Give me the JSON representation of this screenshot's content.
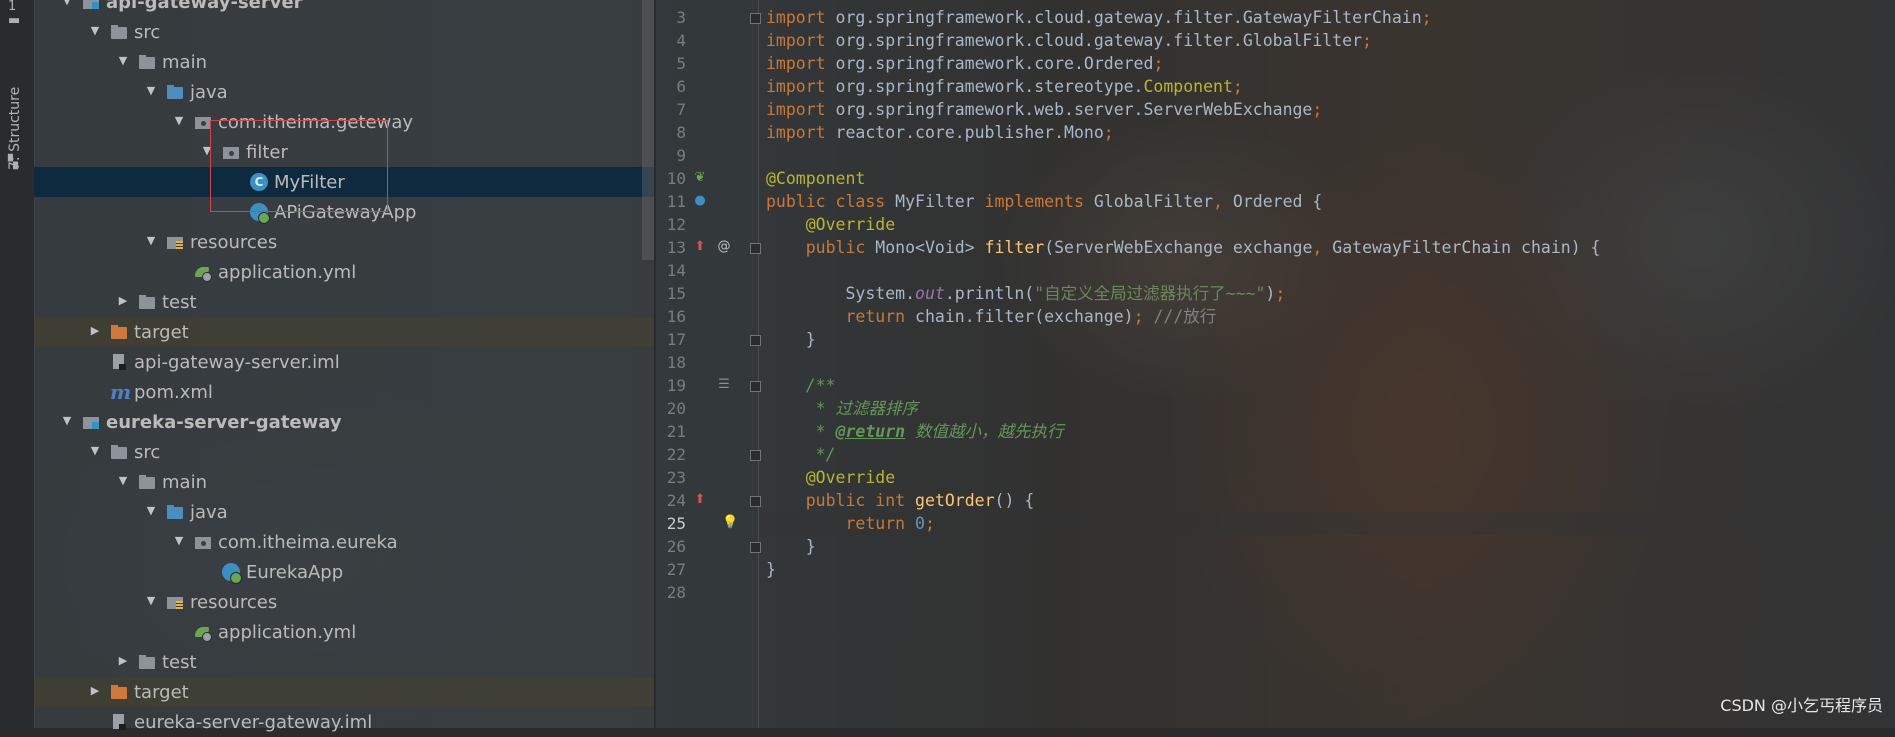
{
  "strip": {
    "number_label": "1",
    "structure_label": "7: Structure"
  },
  "tree": [
    {
      "label": "api-gateway-server",
      "icon": "module",
      "bold": true
    },
    {
      "label": "src",
      "icon": "folder"
    },
    {
      "label": "main",
      "icon": "folder"
    },
    {
      "label": "java",
      "icon": "folder-blue"
    },
    {
      "label": "com.itheima.geteway",
      "icon": "package"
    },
    {
      "label": "filter",
      "icon": "package"
    },
    {
      "label": "MyFilter",
      "icon": "class",
      "selected": true
    },
    {
      "label": "APiGatewayApp",
      "icon": "spring-app"
    },
    {
      "label": "resources",
      "icon": "resources"
    },
    {
      "label": "application.yml",
      "icon": "yml"
    },
    {
      "label": "test",
      "icon": "folder"
    },
    {
      "label": "target",
      "icon": "folder-orange"
    },
    {
      "label": "api-gateway-server.iml",
      "icon": "iml"
    },
    {
      "label": "pom.xml",
      "icon": "maven"
    },
    {
      "label": "eureka-server-gateway",
      "icon": "module",
      "bold": true
    },
    {
      "label": "src",
      "icon": "folder"
    },
    {
      "label": "main",
      "icon": "folder"
    },
    {
      "label": "java",
      "icon": "folder-blue"
    },
    {
      "label": "com.itheima.eureka",
      "icon": "package"
    },
    {
      "label": "EurekaApp",
      "icon": "spring-app"
    },
    {
      "label": "resources",
      "icon": "resources"
    },
    {
      "label": "application.yml",
      "icon": "yml"
    },
    {
      "label": "test",
      "icon": "folder"
    },
    {
      "label": "target",
      "icon": "folder-orange"
    },
    {
      "label": "eureka-server-gateway.iml",
      "icon": "iml"
    }
  ],
  "class_icon_letter": "C",
  "editor": {
    "line_numbers": [
      "3",
      "4",
      "5",
      "6",
      "7",
      "8",
      "9",
      "10",
      "11",
      "12",
      "13",
      "14",
      "15",
      "16",
      "17",
      "18",
      "19",
      "20",
      "21",
      "22",
      "23",
      "24",
      "25",
      "26",
      "27",
      "28"
    ],
    "current_line": "25",
    "code_lines": [
      [
        [
          "k",
          "import "
        ],
        [
          "",
          "org.springframework.cloud.gateway.filter.GatewayFilterChain"
        ],
        [
          "k",
          ";"
        ]
      ],
      [
        [
          "k",
          "import "
        ],
        [
          "",
          "org.springframework.cloud.gateway.filter.GlobalFilter"
        ],
        [
          "k",
          ";"
        ]
      ],
      [
        [
          "k",
          "import "
        ],
        [
          "",
          "org.springframework.core.Ordered"
        ],
        [
          "k",
          ";"
        ]
      ],
      [
        [
          "k",
          "import "
        ],
        [
          "",
          "org.springframework.stereotype."
        ],
        [
          "a",
          "Component"
        ],
        [
          "k",
          ";"
        ]
      ],
      [
        [
          "k",
          "import "
        ],
        [
          "",
          "org.springframework.web.server.ServerWebExchange"
        ],
        [
          "k",
          ";"
        ]
      ],
      [
        [
          "k",
          "import "
        ],
        [
          "",
          "reactor.core.publisher.Mono"
        ],
        [
          "k",
          ";"
        ]
      ],
      [],
      [
        [
          "a",
          "@Component"
        ]
      ],
      [
        [
          "k",
          "public class "
        ],
        [
          "",
          "MyFilter "
        ],
        [
          "k",
          "implements "
        ],
        [
          "",
          "GlobalFilter"
        ],
        [
          "k",
          ", "
        ],
        [
          "",
          "Ordered {"
        ]
      ],
      [
        [
          "",
          "    "
        ],
        [
          "a",
          "@Override"
        ]
      ],
      [
        [
          "",
          "    "
        ],
        [
          "k",
          "public "
        ],
        [
          "",
          "Mono<Void> "
        ],
        [
          "f",
          "filter"
        ],
        [
          "",
          "(ServerWebExchange exchange"
        ],
        [
          "k",
          ", "
        ],
        [
          "",
          "GatewayFilterChain chain) {"
        ]
      ],
      [],
      [
        [
          "",
          "        System."
        ],
        [
          "st",
          "out"
        ],
        [
          "",
          ".println("
        ],
        [
          "s",
          "\"自定义全局过滤器执行了~~~\""
        ],
        [
          "",
          ")"
        ],
        [
          "k",
          ";"
        ]
      ],
      [
        [
          "",
          "        "
        ],
        [
          "k",
          "return "
        ],
        [
          "",
          "chain.filter(exchange)"
        ],
        [
          "k",
          "; "
        ],
        [
          "lc",
          "///放行"
        ]
      ],
      [
        [
          "",
          "    }"
        ]
      ],
      [],
      [
        [
          "c",
          "    /**"
        ]
      ],
      [
        [
          "c",
          "     * 过滤器排序"
        ]
      ],
      [
        [
          "c",
          "     * "
        ],
        [
          "ct",
          "@return"
        ],
        [
          "c",
          " 数值越小，越先执行"
        ]
      ],
      [
        [
          "c",
          "     */"
        ]
      ],
      [
        [
          "",
          "    "
        ],
        [
          "a",
          "@Override"
        ]
      ],
      [
        [
          "",
          "    "
        ],
        [
          "k",
          "public int "
        ],
        [
          "f",
          "getOrder"
        ],
        [
          "",
          "() {"
        ]
      ],
      [
        [
          "",
          "        "
        ],
        [
          "k",
          "return "
        ],
        [
          "n",
          "0"
        ],
        [
          "k",
          ";"
        ]
      ],
      [
        [
          "",
          "    }"
        ]
      ],
      [
        [
          "",
          "}"
        ]
      ],
      []
    ]
  },
  "watermark": "CSDN @小乞丐程序员"
}
